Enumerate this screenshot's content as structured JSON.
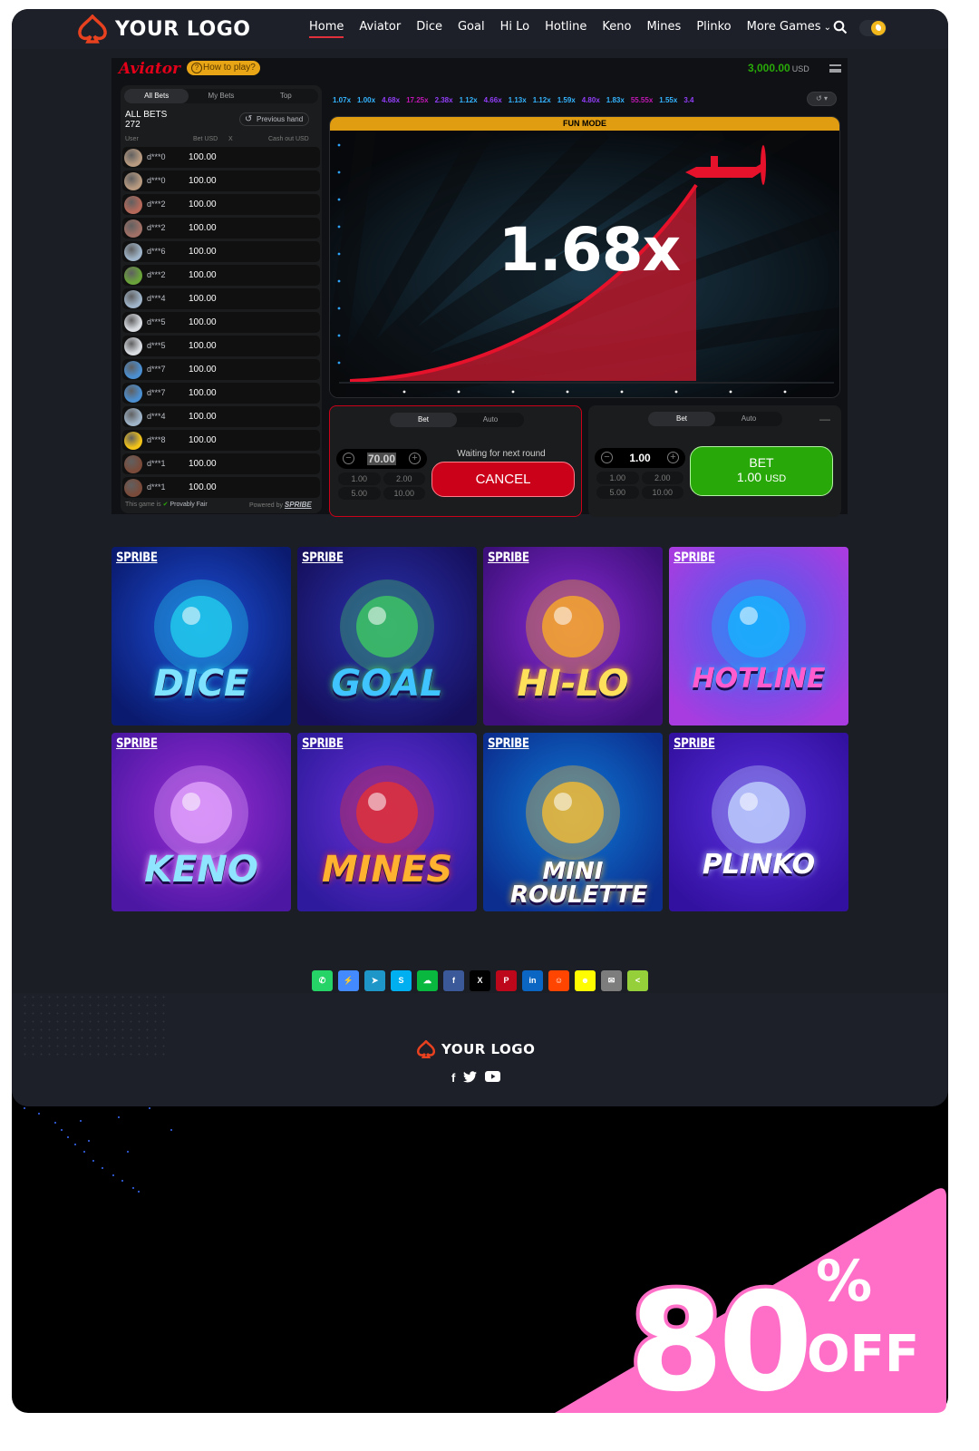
{
  "header": {
    "logo_text": "YOUR LOGO",
    "nav": [
      "Home",
      "Aviator",
      "Dice",
      "Goal",
      "Hi Lo",
      "Hotline",
      "Keno",
      "Mines",
      "Plinko",
      "More Games"
    ],
    "active_nav": "Home"
  },
  "game": {
    "brand": "Aviator",
    "how_to_play": "How to play?",
    "balance": "3,000.00",
    "currency": "USD",
    "bets_tabs": [
      "All Bets",
      "My Bets",
      "Top"
    ],
    "all_bets_label": "ALL BETS",
    "all_bets_count": "272",
    "previous_hand": "Previous hand",
    "columns": {
      "user": "User",
      "bet": "Bet USD",
      "x": "X",
      "cashout": "Cash out USD"
    },
    "rows": [
      {
        "user": "d***0",
        "bet": "100.00",
        "avatar_color": "#b79a80"
      },
      {
        "user": "d***0",
        "bet": "100.00",
        "avatar_color": "#b79a80"
      },
      {
        "user": "d***2",
        "bet": "100.00",
        "avatar_color": "#b5695a"
      },
      {
        "user": "d***2",
        "bet": "100.00",
        "avatar_color": "#a07066"
      },
      {
        "user": "d***6",
        "bet": "100.00",
        "avatar_color": "#9fb4c8"
      },
      {
        "user": "d***2",
        "bet": "100.00",
        "avatar_color": "#6aa33a"
      },
      {
        "user": "d***4",
        "bet": "100.00",
        "avatar_color": "#9fb4c8"
      },
      {
        "user": "d***5",
        "bet": "100.00",
        "avatar_color": "#d9dde2"
      },
      {
        "user": "d***5",
        "bet": "100.00",
        "avatar_color": "#d9dde2"
      },
      {
        "user": "d***7",
        "bet": "100.00",
        "avatar_color": "#4b8fd1"
      },
      {
        "user": "d***7",
        "bet": "100.00",
        "avatar_color": "#4b8fd1"
      },
      {
        "user": "d***4",
        "bet": "100.00",
        "avatar_color": "#9fb4c8"
      },
      {
        "user": "d***8",
        "bet": "100.00",
        "avatar_color": "#f2c318"
      },
      {
        "user": "d***1",
        "bet": "100.00",
        "avatar_color": "#7a4b3a"
      },
      {
        "user": "d***1",
        "bet": "100.00",
        "avatar_color": "#7a4b3a"
      }
    ],
    "fair_prefix": "This game is",
    "fair_label": "Provably Fair",
    "powered_by": "Powered by",
    "powered_brand": "SPRIBE",
    "history": [
      {
        "v": "1.07x",
        "c": "#34b4ff"
      },
      {
        "v": "1.00x",
        "c": "#34b4ff"
      },
      {
        "v": "4.68x",
        "c": "#913ef8"
      },
      {
        "v": "17.25x",
        "c": "#c017b4"
      },
      {
        "v": "2.38x",
        "c": "#913ef8"
      },
      {
        "v": "1.12x",
        "c": "#34b4ff"
      },
      {
        "v": "4.66x",
        "c": "#913ef8"
      },
      {
        "v": "1.13x",
        "c": "#34b4ff"
      },
      {
        "v": "1.12x",
        "c": "#34b4ff"
      },
      {
        "v": "1.59x",
        "c": "#34b4ff"
      },
      {
        "v": "4.80x",
        "c": "#913ef8"
      },
      {
        "v": "1.83x",
        "c": "#34b4ff"
      },
      {
        "v": "55.55x",
        "c": "#c017b4"
      },
      {
        "v": "1.55x",
        "c": "#34b4ff"
      },
      {
        "v": "3.4",
        "c": "#913ef8"
      }
    ],
    "fun_mode": "FUN MODE",
    "multiplier": "1.68x",
    "panel1": {
      "tabs": [
        "Bet",
        "Auto"
      ],
      "amount": "70.00",
      "quick": [
        "1.00",
        "2.00",
        "5.00",
        "10.00"
      ],
      "waiting": "Waiting for next round",
      "cancel": "CANCEL"
    },
    "panel2": {
      "tabs": [
        "Bet",
        "Auto"
      ],
      "amount": "1.00",
      "quick": [
        "1.00",
        "2.00",
        "5.00",
        "10.00"
      ],
      "bet_label": "BET",
      "bet_amount": "1.00",
      "bet_currency": "USD"
    }
  },
  "tiles": [
    {
      "brand": "SPRIBE",
      "title": "DICE",
      "bg1": "#1d4fd8",
      "bg2": "#0a1a6e",
      "accent": "#22d3ee",
      "text_color": "#7fe3ff"
    },
    {
      "brand": "SPRIBE",
      "title": "GOAL",
      "bg1": "#2b33b0",
      "bg2": "#150f5c",
      "accent": "#3ecf5f",
      "text_color": "#40c4ff"
    },
    {
      "brand": "SPRIBE",
      "title": "HI-LO",
      "bg1": "#8a2bd6",
      "bg2": "#3d0f7a",
      "accent": "#ffb020",
      "text_color": "#ffe05a"
    },
    {
      "brand": "SPRIBE",
      "title": "HOTLINE",
      "bg1": "#3e62f0",
      "bg2": "#a83ce0",
      "accent": "#16b7ff",
      "text_color": "#ff5cd0"
    },
    {
      "brand": "SPRIBE",
      "title": "KENO",
      "bg1": "#9a2dd4",
      "bg2": "#4b17a3",
      "accent": "#e6a8ff",
      "text_color": "#8fe4ff"
    },
    {
      "brand": "SPRIBE",
      "title": "MINES",
      "bg1": "#6a2fd9",
      "bg2": "#2e1a9c",
      "accent": "#e8312c",
      "text_color": "#ffb230"
    },
    {
      "brand": "SPRIBE",
      "title": "MINI ROULETTE",
      "bg1": "#0f7ad6",
      "bg2": "#0b2e8f",
      "accent": "#ffbf2e",
      "text_color": "#ffffff"
    },
    {
      "brand": "SPRIBE",
      "title": "PLINKO",
      "bg1": "#5a2ee0",
      "bg2": "#3311a0",
      "accent": "#c3d8ff",
      "text_color": "#ffffff"
    }
  ],
  "share": [
    {
      "icon": "whatsapp-icon",
      "glyph": "✆",
      "color": "#25d366"
    },
    {
      "icon": "messenger-icon",
      "glyph": "⚡",
      "color": "#448aff"
    },
    {
      "icon": "telegram-icon",
      "glyph": "➤",
      "color": "#1e96c8"
    },
    {
      "icon": "skype-icon",
      "glyph": "S",
      "color": "#00aff0"
    },
    {
      "icon": "wechat-icon",
      "glyph": "☁",
      "color": "#09b83e"
    },
    {
      "icon": "facebook-icon",
      "glyph": "f",
      "color": "#3b5998"
    },
    {
      "icon": "x-icon",
      "glyph": "X",
      "color": "#000000"
    },
    {
      "icon": "pinterest-icon",
      "glyph": "P",
      "color": "#bd081c"
    },
    {
      "icon": "linkedin-icon",
      "glyph": "in",
      "color": "#0a66c2"
    },
    {
      "icon": "reddit-icon",
      "glyph": "☺",
      "color": "#ff4500"
    },
    {
      "icon": "snapchat-icon",
      "glyph": "☻",
      "color": "#fffc00"
    },
    {
      "icon": "email-icon",
      "glyph": "✉",
      "color": "#7d7d7d"
    },
    {
      "icon": "sharethis-icon",
      "glyph": "<",
      "color": "#95d03a"
    }
  ],
  "footer": {
    "logo_text": "YOUR LOGO",
    "socials": [
      "f",
      "🐦",
      "▶"
    ]
  },
  "promo": {
    "number": "80",
    "percent": "%",
    "off": "OFF",
    "color": "#ff6fc8"
  }
}
